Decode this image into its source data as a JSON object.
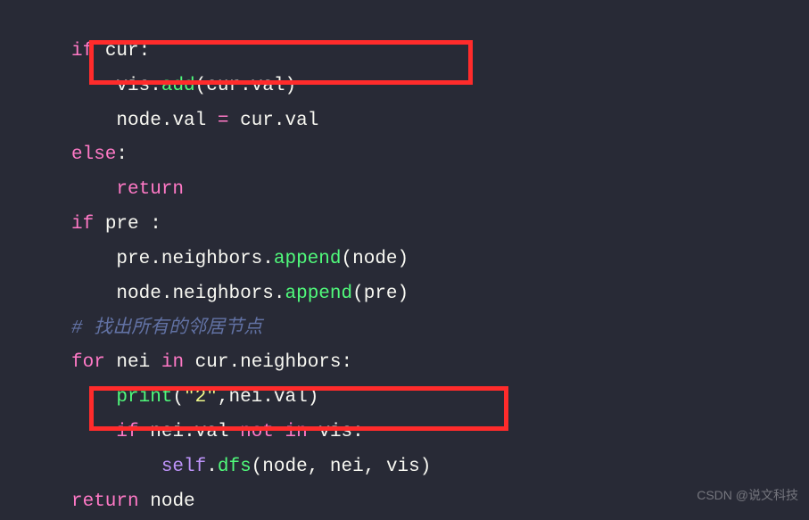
{
  "code": {
    "l1_if": "if",
    "l1_cur": "cur",
    "l1_colon": ":",
    "l2_vis": "vis",
    "l2_add": "add",
    "l2_cur": "cur",
    "l2_val": "val",
    "l3_node": "node",
    "l3_val1": "val",
    "l3_eq": "=",
    "l3_cur": "cur",
    "l3_val2": "val",
    "l4_else": "else",
    "l5_return": "return",
    "l6_if": "if",
    "l6_pre": "pre",
    "l7_pre": "pre",
    "l7_neighbors": "neighbors",
    "l7_append": "append",
    "l7_node": "node",
    "l8_node": "node",
    "l8_neighbors": "neighbors",
    "l8_append": "append",
    "l8_pre": "pre",
    "l9_comment": "# 找出所有的邻居节点",
    "l10_for": "for",
    "l10_nei": "nei",
    "l10_in": "in",
    "l10_cur": "cur",
    "l10_neighbors": "neighbors",
    "l11_print": "print",
    "l11_str": "\"2\"",
    "l11_nei": "nei",
    "l11_val": "val",
    "l12_if": "if",
    "l12_nei": "nei",
    "l12_val": "val",
    "l12_not": "not",
    "l12_in": "in",
    "l12_vis": "vis",
    "l13_self": "self",
    "l13_dfs": "dfs",
    "l13_node": "node",
    "l13_nei": "nei",
    "l13_vis": "vis",
    "l14_return": "return",
    "l14_node": "node"
  },
  "watermark": "CSDN @说文科技"
}
